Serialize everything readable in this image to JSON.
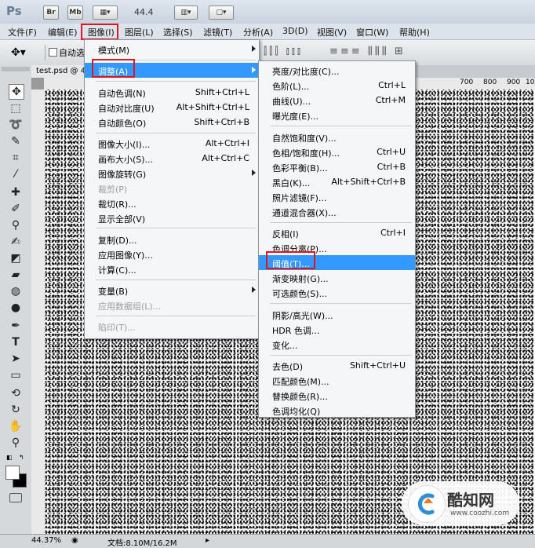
{
  "app": {
    "logo": "Ps",
    "bridge_btn": "Br",
    "minibridge_btn": "Mb",
    "zoom_value": "44.4"
  },
  "menubar": [
    "文件(F)",
    "编辑(E)",
    "图像(I)",
    "图层(L)",
    "选择(S)",
    "滤镜(T)",
    "分析(A)",
    "3D(D)",
    "视图(V)",
    "窗口(W)",
    "帮助(H)"
  ],
  "options": {
    "auto_select_label": "自动选"
  },
  "document": {
    "tab_title": "test.psd @ 4",
    "ruler_numbers": [
      "700",
      "800",
      "900",
      "1000"
    ]
  },
  "image_menu": [
    {
      "label": "模式(M)",
      "shortcut": "",
      "submenu": true,
      "disabled": false
    },
    {
      "sep": true
    },
    {
      "label": "调整(A)",
      "shortcut": "",
      "submenu": true,
      "disabled": false,
      "highlighted": true
    },
    {
      "sep": true
    },
    {
      "label": "自动色调(N)",
      "shortcut": "Shift+Ctrl+L",
      "submenu": false,
      "disabled": false
    },
    {
      "label": "自动对比度(U)",
      "shortcut": "Alt+Shift+Ctrl+L",
      "submenu": false,
      "disabled": false
    },
    {
      "label": "自动颜色(O)",
      "shortcut": "Shift+Ctrl+B",
      "submenu": false,
      "disabled": false
    },
    {
      "sep": true
    },
    {
      "label": "图像大小(I)...",
      "shortcut": "Alt+Ctrl+I",
      "submenu": false,
      "disabled": false
    },
    {
      "label": "画布大小(S)...",
      "shortcut": "Alt+Ctrl+C",
      "submenu": false,
      "disabled": false
    },
    {
      "label": "图像旋转(G)",
      "shortcut": "",
      "submenu": true,
      "disabled": false
    },
    {
      "label": "裁剪(P)",
      "shortcut": "",
      "submenu": false,
      "disabled": true
    },
    {
      "label": "裁切(R)...",
      "shortcut": "",
      "submenu": false,
      "disabled": false
    },
    {
      "label": "显示全部(V)",
      "shortcut": "",
      "submenu": false,
      "disabled": false
    },
    {
      "sep": true
    },
    {
      "label": "复制(D)...",
      "shortcut": "",
      "submenu": false,
      "disabled": false
    },
    {
      "label": "应用图像(Y)...",
      "shortcut": "",
      "submenu": false,
      "disabled": false
    },
    {
      "label": "计算(C)...",
      "shortcut": "",
      "submenu": false,
      "disabled": false
    },
    {
      "sep": true
    },
    {
      "label": "变量(B)",
      "shortcut": "",
      "submenu": true,
      "disabled": false
    },
    {
      "label": "应用数据组(L)...",
      "shortcut": "",
      "submenu": false,
      "disabled": true
    },
    {
      "sep": true
    },
    {
      "label": "陷印(T)...",
      "shortcut": "",
      "submenu": false,
      "disabled": true
    }
  ],
  "adjust_menu": [
    {
      "label": "亮度/对比度(C)...",
      "shortcut": ""
    },
    {
      "label": "色阶(L)...",
      "shortcut": "Ctrl+L"
    },
    {
      "label": "曲线(U)...",
      "shortcut": "Ctrl+M"
    },
    {
      "label": "曝光度(E)...",
      "shortcut": ""
    },
    {
      "sep": true
    },
    {
      "label": "自然饱和度(V)...",
      "shortcut": ""
    },
    {
      "label": "色相/饱和度(H)...",
      "shortcut": "Ctrl+U"
    },
    {
      "label": "色彩平衡(B)...",
      "shortcut": "Ctrl+B"
    },
    {
      "label": "黑白(K)...",
      "shortcut": "Alt+Shift+Ctrl+B"
    },
    {
      "label": "照片滤镜(F)...",
      "shortcut": ""
    },
    {
      "label": "通道混合器(X)...",
      "shortcut": ""
    },
    {
      "sep": true
    },
    {
      "label": "反相(I)",
      "shortcut": "Ctrl+I"
    },
    {
      "label": "色调分离(P)...",
      "shortcut": ""
    },
    {
      "label": "阈值(T)...",
      "shortcut": "",
      "highlighted": true
    },
    {
      "label": "渐变映射(G)...",
      "shortcut": ""
    },
    {
      "label": "可选颜色(S)...",
      "shortcut": ""
    },
    {
      "sep": true
    },
    {
      "label": "阴影/高光(W)...",
      "shortcut": ""
    },
    {
      "label": "HDR 色调...",
      "shortcut": ""
    },
    {
      "label": "变化...",
      "shortcut": ""
    },
    {
      "sep": true
    },
    {
      "label": "去色(D)",
      "shortcut": "Shift+Ctrl+U"
    },
    {
      "label": "匹配颜色(M)...",
      "shortcut": ""
    },
    {
      "label": "替换颜色(R)...",
      "shortcut": ""
    },
    {
      "label": "色调均化(Q)",
      "shortcut": ""
    }
  ],
  "status": {
    "zoom": "44.37%",
    "doc_info": "文档:8.10M/16.2M"
  },
  "watermark": {
    "brand": "酷知网",
    "url": "www.coozhi.com"
  },
  "colors": {
    "highlight": "#3399ff",
    "annotation_red": "#e0161f"
  }
}
